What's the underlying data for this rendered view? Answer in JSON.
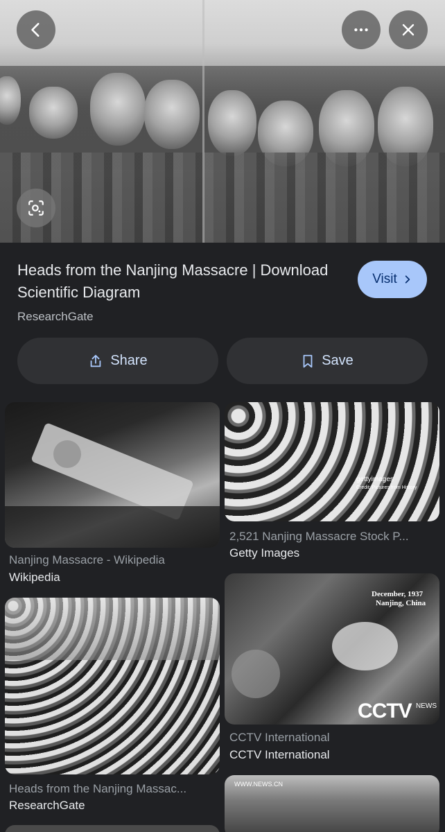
{
  "header": {
    "back_icon": "chevron-left-icon",
    "more_icon": "more-horiz-icon",
    "close_icon": "close-icon",
    "lens_icon": "google-lens-icon"
  },
  "result": {
    "title": "Heads from the Nanjing Massacre | Download Scientific Diagram",
    "source": "ResearchGate",
    "visit_label": "Visit",
    "share_label": "Share",
    "save_label": "Save"
  },
  "related": [
    {
      "title": "Nanjing Massacre - Wikipedia",
      "source": "Wikipedia"
    },
    {
      "title": "2,521 Nanjing Massacre Stock P...",
      "source": "Getty Images",
      "watermark": "gettyimages",
      "credit": "Credit: Pictures from History"
    },
    {
      "title": "Heads from the Nanjing Massac...",
      "source": "ResearchGate"
    },
    {
      "title": "CCTV International",
      "source": "CCTV International",
      "caption_line1": "December, 1937",
      "caption_line2": "Nanjing, China",
      "logo": "CCTV",
      "logo_sub": "NEWS"
    },
    {
      "watermark": "WWW.NEWS.CN"
    }
  ],
  "colors": {
    "background": "#202124",
    "visit_button": "#a8c7fa",
    "action_button": "#303134",
    "action_text": "#d2e3fc"
  }
}
